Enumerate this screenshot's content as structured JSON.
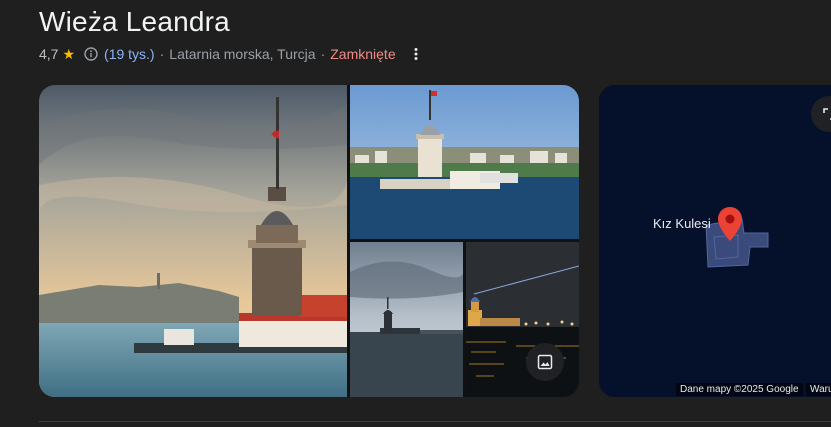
{
  "place": {
    "title": "Wieża Leandra",
    "rating": "4,7",
    "review_count": "(19 tys.)",
    "category": "Latarnia morska, Turcja",
    "separator": "·",
    "status": "Zamknięte"
  },
  "icons": {
    "star": "star-icon",
    "info": "info-icon",
    "more": "more-vert-icon",
    "photos": "photo-gallery-icon",
    "expand": "expand-icon",
    "pin": "map-pin-icon"
  },
  "map": {
    "label": "Kız Kulesi",
    "attribution": "Dane mapy ©2025 Google",
    "terms": "Warui"
  },
  "colors": {
    "background": "#1f1f1f",
    "link": "#8ab4f8",
    "status_closed": "#f28b82",
    "star": "#fbbc04",
    "map_background": "#05102a",
    "pin": "#ea4335"
  }
}
